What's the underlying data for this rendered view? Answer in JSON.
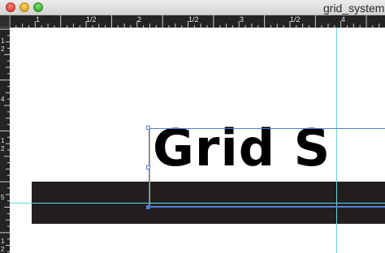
{
  "window": {
    "title": "grid_systems",
    "buttons": {
      "close": "close-button",
      "minimize": "minimize-button",
      "zoom": "zoom-button"
    }
  },
  "rulers": {
    "horizontal_labels": [
      "1",
      "1/2",
      "1/2",
      "2",
      "1/2",
      "3",
      "1/2",
      "4"
    ],
    "vertical_labels": [
      "1",
      "2",
      "4",
      "1",
      "2",
      "5",
      "1",
      "2"
    ]
  },
  "document": {
    "headline": "Grid S"
  },
  "colors": {
    "bar": "#231f20",
    "guide": "#5fd8e8",
    "selection": "#4f7fd6",
    "ruler": "#242424"
  }
}
